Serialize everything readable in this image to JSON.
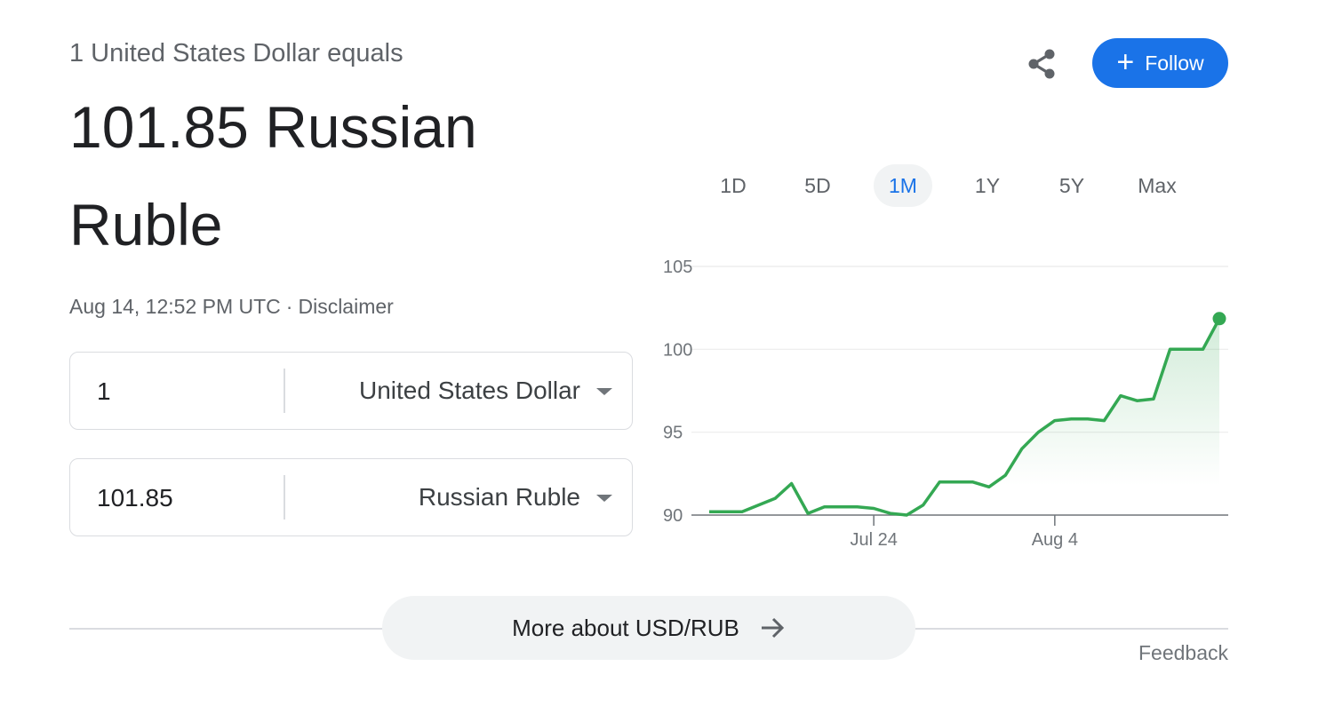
{
  "header": {
    "subhead": "1 United States Dollar equals",
    "value_line1": "101.85 Russian",
    "value_line2": "Ruble",
    "timestamp": "Aug 14, 12:52 PM UTC",
    "separator": "·",
    "disclaimer": "Disclaimer"
  },
  "actions": {
    "share_icon": "share-icon",
    "follow_label": "Follow",
    "follow_color": "#1a73e8"
  },
  "converter": {
    "from": {
      "amount": "1",
      "currency": "United States Dollar"
    },
    "to": {
      "amount": "101.85",
      "currency": "Russian Ruble"
    }
  },
  "range_tabs": {
    "items": [
      "1D",
      "5D",
      "1M",
      "1Y",
      "5Y",
      "Max"
    ],
    "selected": "1M"
  },
  "chart_data": {
    "type": "area",
    "x_tick_labels": [
      "Jul 24",
      "Aug 4"
    ],
    "y_tick_labels": [
      "105",
      "100",
      "95",
      "90"
    ],
    "ylim": [
      90,
      105
    ],
    "grid": true,
    "line_color": "#34a853",
    "series": [
      {
        "values": [
          90.2,
          90.2,
          90.2,
          90.6,
          91.0,
          91.9,
          90.1,
          90.5,
          90.5,
          90.5,
          90.4,
          90.1,
          90.0,
          90.6,
          92.0,
          92.0,
          92.0,
          91.7,
          92.4,
          94.0,
          95.0,
          95.7,
          95.8,
          95.8,
          95.7,
          97.2,
          96.9,
          97.0,
          100.0,
          100.0,
          100.0,
          101.85
        ]
      }
    ]
  },
  "footer": {
    "more_label": "More about USD/RUB",
    "more_icon": "arrow-right-icon",
    "feedback": "Feedback"
  }
}
